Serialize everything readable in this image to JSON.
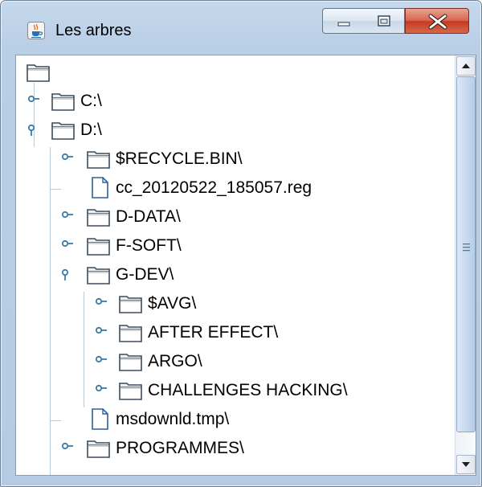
{
  "window": {
    "title": "Les arbres",
    "icons": {
      "app": "java-cup-icon",
      "minimize": "minimize-icon",
      "maximize": "maximize-icon",
      "close": "close-icon"
    },
    "colors": {
      "close_button": "#c8432a",
      "frame": "#b9cfe6"
    }
  },
  "tree": {
    "nodes": [
      {
        "label": "",
        "type": "folder",
        "depth": 0,
        "state": "root"
      },
      {
        "label": "C:\\",
        "type": "folder",
        "depth": 1,
        "state": "collapsed"
      },
      {
        "label": "D:\\",
        "type": "folder",
        "depth": 1,
        "state": "expanded"
      },
      {
        "label": "$RECYCLE.BIN\\",
        "type": "folder",
        "depth": 2,
        "state": "collapsed"
      },
      {
        "label": "cc_20120522_185057.reg",
        "type": "file",
        "depth": 2,
        "state": "leaf"
      },
      {
        "label": "D-DATA\\",
        "type": "folder",
        "depth": 2,
        "state": "collapsed"
      },
      {
        "label": "F-SOFT\\",
        "type": "folder",
        "depth": 2,
        "state": "collapsed"
      },
      {
        "label": "G-DEV\\",
        "type": "folder",
        "depth": 2,
        "state": "expanded"
      },
      {
        "label": "$AVG\\",
        "type": "folder",
        "depth": 3,
        "state": "collapsed"
      },
      {
        "label": "AFTER EFFECT\\",
        "type": "folder",
        "depth": 3,
        "state": "collapsed"
      },
      {
        "label": "ARGO\\",
        "type": "folder",
        "depth": 3,
        "state": "collapsed"
      },
      {
        "label": "CHALLENGES HACKING\\",
        "type": "folder",
        "depth": 3,
        "state": "collapsed"
      },
      {
        "label": "msdownld.tmp\\",
        "type": "file",
        "depth": 2,
        "state": "leaf"
      },
      {
        "label": "PROGRAMMES\\",
        "type": "folder",
        "depth": 2,
        "state": "collapsed"
      }
    ]
  },
  "scrollbar": {
    "up_icon": "arrow-up-icon",
    "down_icon": "arrow-down-icon",
    "grip_icon": "grip-icon"
  }
}
